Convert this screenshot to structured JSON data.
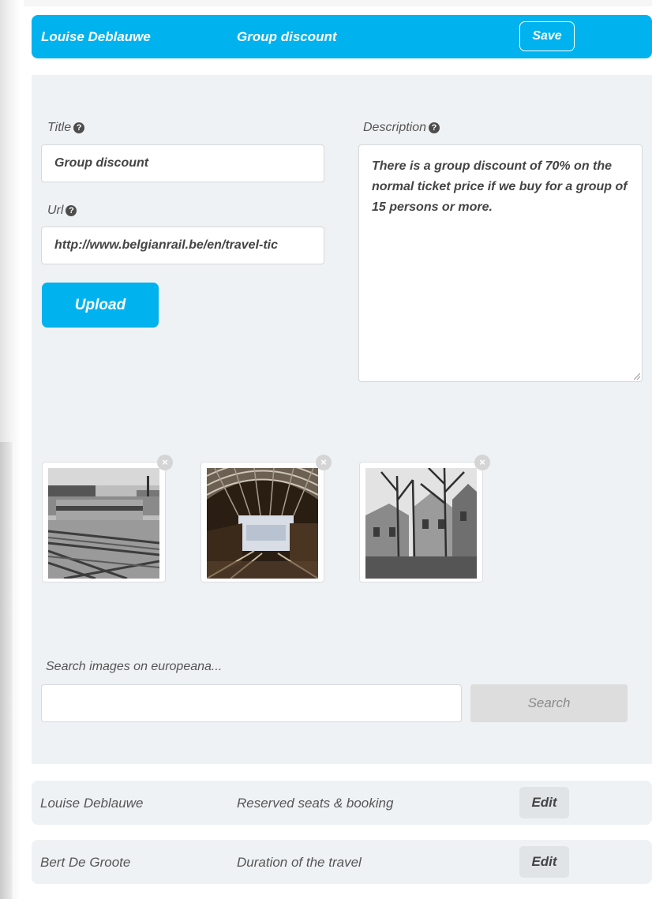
{
  "active_item": {
    "author": "Louise Deblauwe",
    "title": "Group discount",
    "save_label": "Save"
  },
  "form": {
    "title_label": "Title",
    "title_value": "Group discount",
    "url_label": "Url",
    "url_value": "http://www.belgianrail.be/en/travel-tic",
    "description_label": "Description",
    "description_value": "There is a group discount of 70% on the normal ticket price if we buy for a group of 15 persons or more.",
    "upload_label": "Upload"
  },
  "images": [
    {
      "subject": "train-photo",
      "remove_glyph": "×"
    },
    {
      "subject": "station-hall-photo",
      "remove_glyph": "×"
    },
    {
      "subject": "houses-trees-photo",
      "remove_glyph": "×"
    }
  ],
  "search": {
    "label": "Search images on europeana...",
    "value": "",
    "button_label": "Search"
  },
  "rows": [
    {
      "author": "Louise Deblauwe",
      "title": "Reserved seats & booking",
      "edit_label": "Edit"
    },
    {
      "author": "Bert De Groote",
      "title": "Duration of the travel",
      "edit_label": "Edit"
    }
  ],
  "colors": {
    "accent": "#00b2ee",
    "panel_bg": "#eff2f4",
    "search_button_bg": "#dddddd"
  },
  "icons": {
    "help": "question-circle-icon",
    "remove": "close-circle-icon"
  }
}
